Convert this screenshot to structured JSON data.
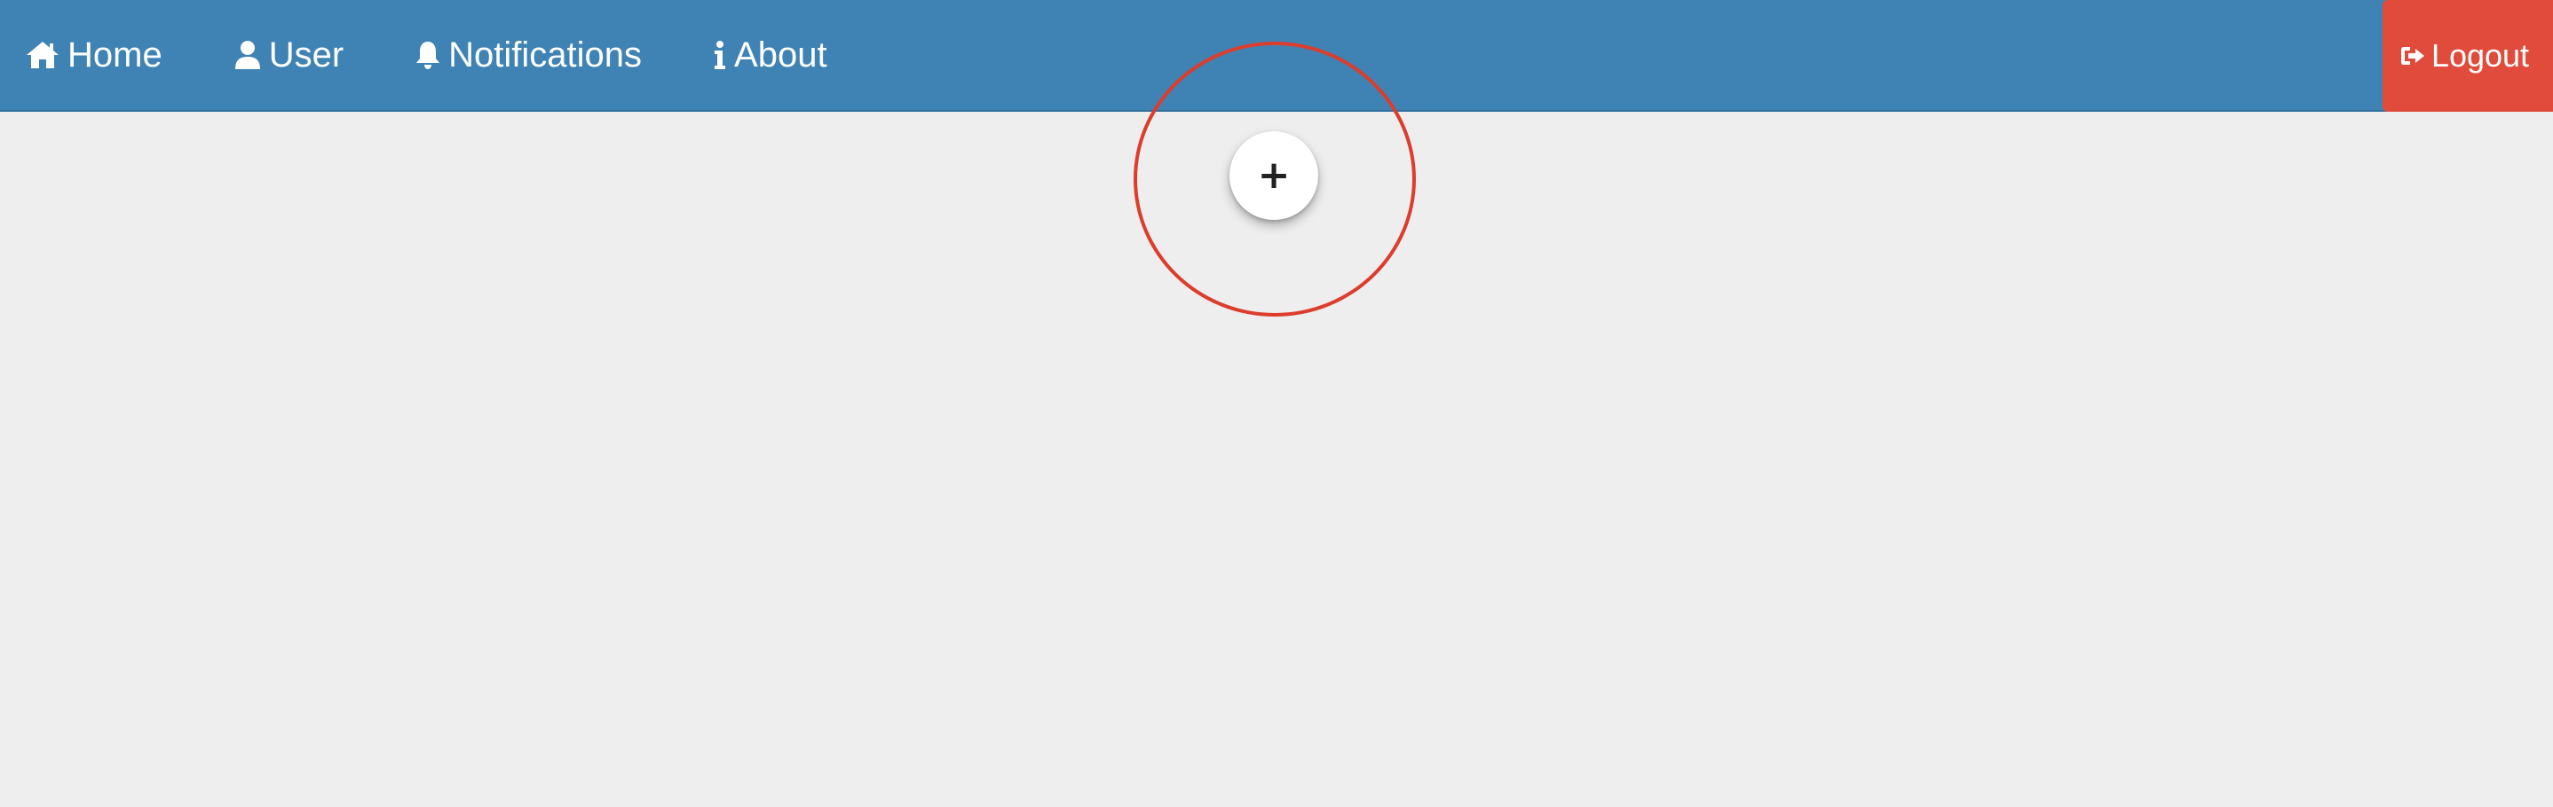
{
  "navbar": {
    "background_color": "#3f83b5",
    "items": [
      {
        "label": "Home",
        "icon": "home-icon"
      },
      {
        "label": "User",
        "icon": "user-icon"
      },
      {
        "label": "Notifications",
        "icon": "bell-icon"
      },
      {
        "label": "About",
        "icon": "info-icon"
      }
    ],
    "logout": {
      "label": "Logout",
      "icon": "sign-out-icon",
      "color": "#e14b3b"
    }
  },
  "main": {
    "background_color": "#eeeeee",
    "add_button": {
      "label": "+",
      "icon": "plus-icon"
    },
    "highlight_color": "#dc3d2c"
  }
}
